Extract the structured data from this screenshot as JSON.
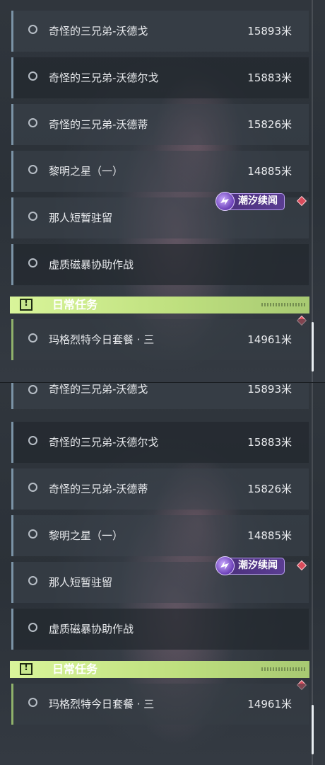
{
  "quests": [
    {
      "name": "奇怪的三兄弟-沃德戈",
      "distance": "15893米"
    },
    {
      "name": "奇怪的三兄弟-沃德尔戈",
      "distance": "15883米"
    },
    {
      "name": "奇怪的三兄弟-沃德蒂",
      "distance": "15826米"
    },
    {
      "name": "黎明之星（一）",
      "distance": "14885米"
    },
    {
      "name": "那人短暂驻留",
      "distance": ""
    },
    {
      "name": "虚质磁暴协助作战",
      "distance": ""
    }
  ],
  "event_tag": {
    "label": "潮汐续闻",
    "icon": "tide-event-icon"
  },
  "section": {
    "title": "日常任务",
    "icon_glyph": "!"
  },
  "daily_quest": {
    "name": "玛格烈特今日套餐 · 三",
    "distance": "14961米"
  },
  "colors": {
    "quest_accent": "#7b93a6",
    "daily_accent": "#8fb16b",
    "section_bg": "#c8e88e",
    "tag_bg": "#5a3d92",
    "marker": "#d94b5b"
  }
}
